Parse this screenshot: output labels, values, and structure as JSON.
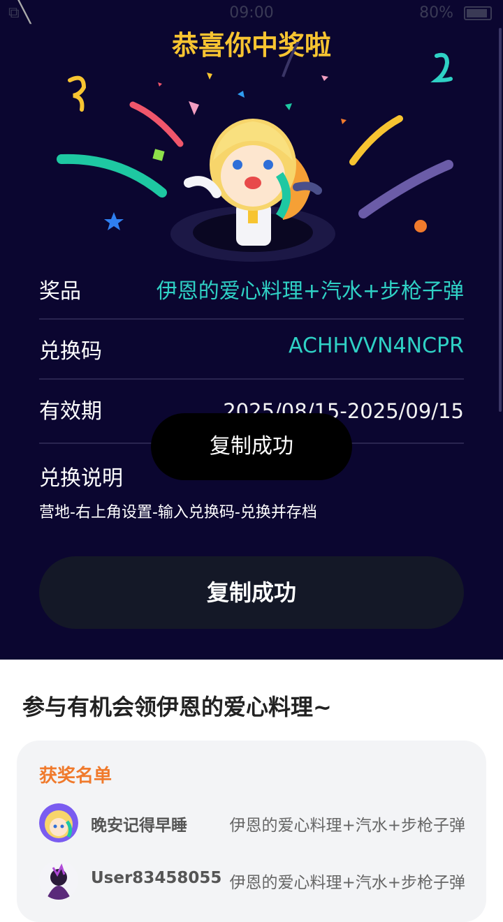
{
  "status_bar": {
    "time": "09:00",
    "battery": "80%"
  },
  "header": {
    "title": "恭喜你中奖啦"
  },
  "details": {
    "prize_label": "奖品",
    "prize_value": "伊恩的爱心料理+汽水+步枪子弹",
    "code_label": "兑换码",
    "code_value": "ACHHVVN4NCPR",
    "validity_label": "有效期",
    "validity_value": "2025/08/15-2025/09/15",
    "instructions_label": "兑换说明",
    "instructions_text": "营地-右上角设置-输入兑换码-兑换并存档"
  },
  "toast": {
    "text": "复制成功"
  },
  "copy_button": {
    "label": "复制成功"
  },
  "promo": {
    "title": "参与有机会领伊恩的爱心料理~"
  },
  "winners": {
    "title": "获奖名单",
    "items": [
      {
        "name": "晚安记得早睡",
        "prize": "伊恩的爱心料理+汽水+步枪子弹"
      },
      {
        "name": "User83458055",
        "prize": "伊恩的爱心料理+汽水+步枪子弹"
      }
    ]
  },
  "colors": {
    "top_background": "#0b0630",
    "title": "#f7c431",
    "accent_teal": "#2fd1c5",
    "winners_title": "#f07a2c",
    "button_background": "#141827"
  }
}
